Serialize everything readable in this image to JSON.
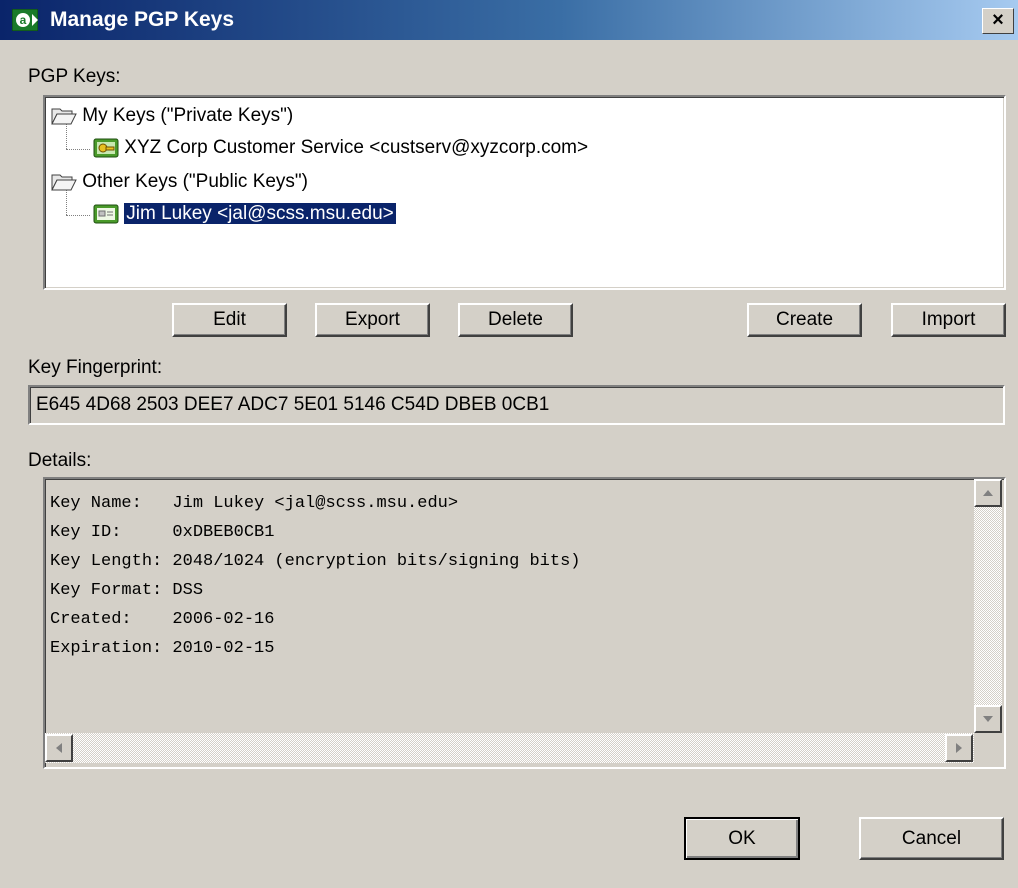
{
  "window": {
    "title": "Manage PGP Keys",
    "close_glyph": "×"
  },
  "pgp_keys": {
    "label": "PGP Keys:",
    "tree": [
      {
        "label": "My Keys (\"Private Keys\")",
        "icon": "folder-open-icon",
        "children": [
          {
            "label": "XYZ Corp Customer Service <custserv@xyzcorp.com>",
            "icon": "private-key-icon"
          }
        ]
      },
      {
        "label": "Other Keys (\"Public Keys\")",
        "icon": "folder-open-icon",
        "children": [
          {
            "label": "Jim Lukey <jal@scss.msu.edu>",
            "icon": "public-key-icon",
            "selected": true
          }
        ]
      }
    ]
  },
  "buttons": {
    "edit": "Edit",
    "export": "Export",
    "delete": "Delete",
    "create": "Create",
    "import": "Import",
    "ok": "OK",
    "cancel": "Cancel"
  },
  "fingerprint": {
    "label": "Key Fingerprint:",
    "value": "E645 4D68 2503 DEE7 ADC7 5E01 5146 C54D DBEB 0CB1"
  },
  "details": {
    "label": "Details:",
    "text": "Key Name:   Jim Lukey <jal@scss.msu.edu>\nKey ID:     0xDBEB0CB1\nKey Length: 2048/1024 (encryption bits/signing bits)\nKey Format: DSS\nCreated:    2006-02-16\nExpiration: 2010-02-15"
  },
  "colors": {
    "titlebar_start": "#0a246a",
    "titlebar_end": "#a6caf0",
    "selection": "#0a246a",
    "face": "#d4d0c8"
  }
}
